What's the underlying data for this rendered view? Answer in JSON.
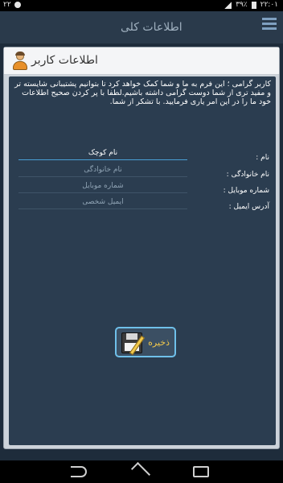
{
  "status_bar": {
    "time": "۲۲:۰۱",
    "battery": "۳۹٪",
    "notification_count": "۲۲"
  },
  "app": {
    "title": "اطلاعات کلی"
  },
  "dialog": {
    "title": "اطلاعات کاربر",
    "intro_text": "کاربر گرامی ؛ این فرم به ما و شما کمک خواهد کرد تا بتوانیم پشتیبانی شایسته تر و مفید تری از شما دوست گرامی داشته باشیم.لطفا با پر کردن صحیح اطلاعات خود ما را در این امر یاری فرمایید. با تشکر از شما.",
    "fields": [
      {
        "label": "نام :",
        "value": "نام کوچک"
      },
      {
        "label": "نام خانوادگی :",
        "placeholder": "نام خانوادگی"
      },
      {
        "label": "شماره موبایل :",
        "placeholder": "شماره موبایل"
      },
      {
        "label": "آدرس ایمیل :",
        "placeholder": "ایمیل شخصی"
      }
    ],
    "save_label": "ذخیره"
  },
  "icons": {
    "user": "user-icon",
    "save": "floppy-disk-icon",
    "menu": "menu-icon"
  }
}
